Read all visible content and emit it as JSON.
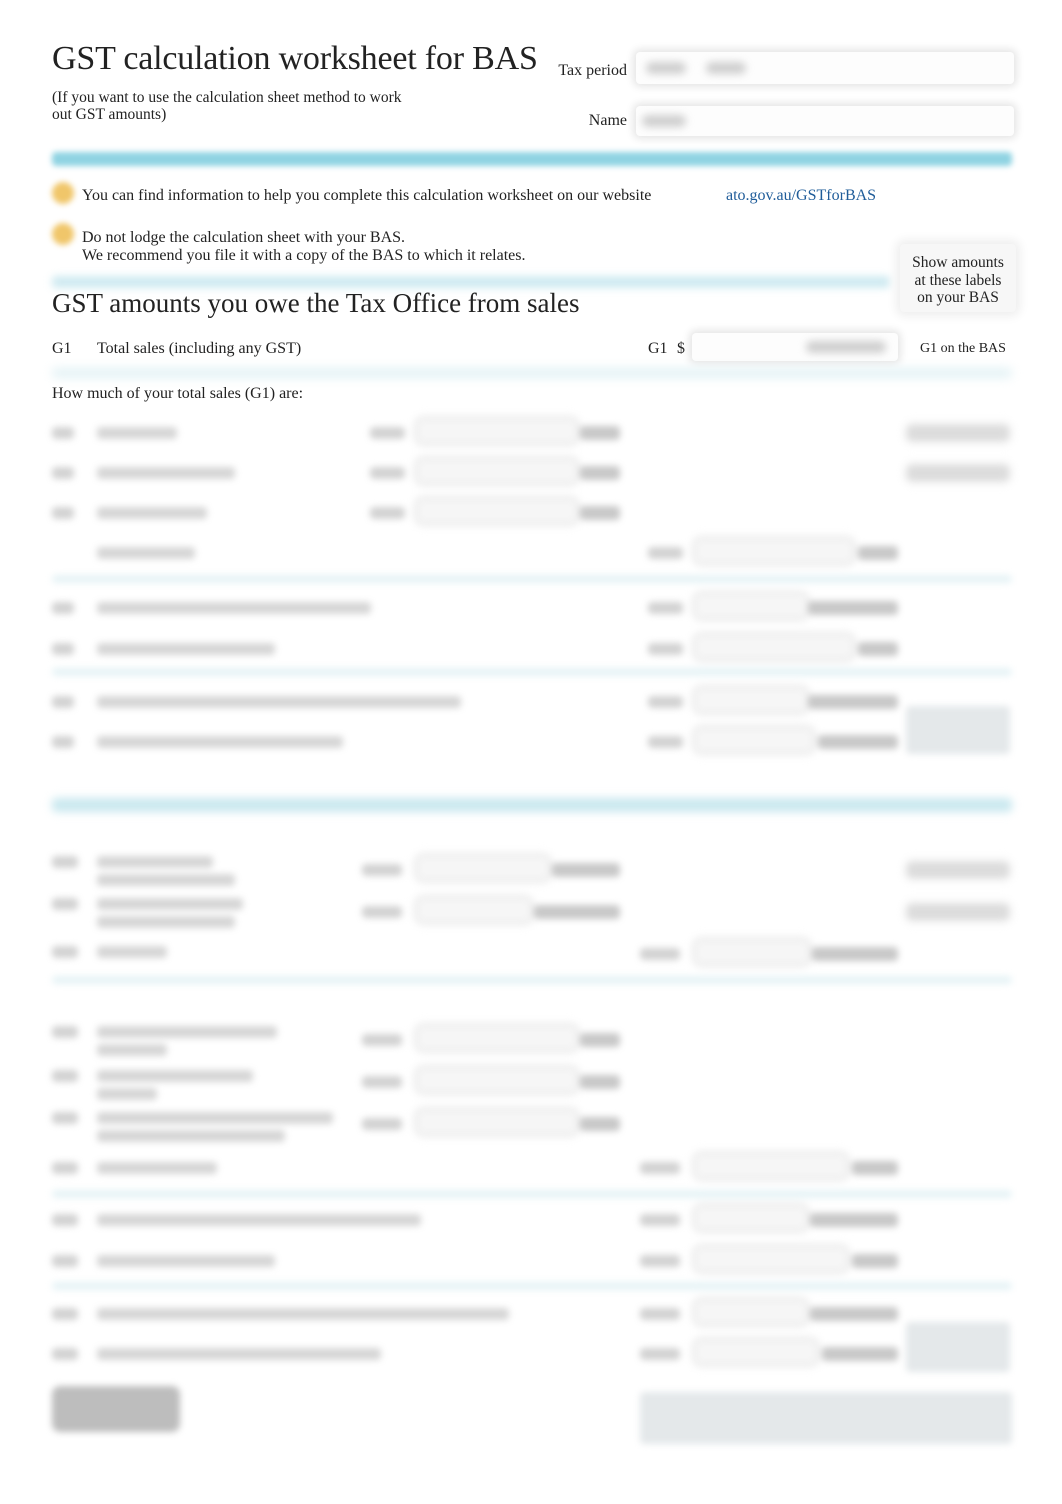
{
  "header": {
    "title": "GST calculation worksheet for BAS",
    "subtitle": "(If you want to use the calculation sheet method to work out GST amounts)",
    "tax_period_label": "Tax period",
    "name_label": "Name"
  },
  "info": {
    "note1": "You can find information to help you complete this calculation worksheet on our website",
    "note1_link": "ato.gov.au/GSTforBAS",
    "note2_line1": "Do not lodge the calculation sheet with your BAS.",
    "note2_line2": "We recommend you file it with a copy of the BAS to which it relates.",
    "note_icon": "info-dot-icon"
  },
  "sales_section": {
    "title": "GST amounts you owe the Tax Office from sales",
    "show_amounts_box": {
      "line1": "Show amounts",
      "line2": "at these labels",
      "line3": "on your BAS"
    },
    "g1": {
      "code": "G1",
      "label": "Total sales (including any GST)",
      "field_code": "G1",
      "currency": "$",
      "bas_label": "G1 on the BAS"
    },
    "how_much_label": "How much of your total sales (G1) are:"
  },
  "colors": {
    "band_accent": "#8fd3e2",
    "link": "#1f5c99",
    "info_dot": "#f0c66a"
  }
}
